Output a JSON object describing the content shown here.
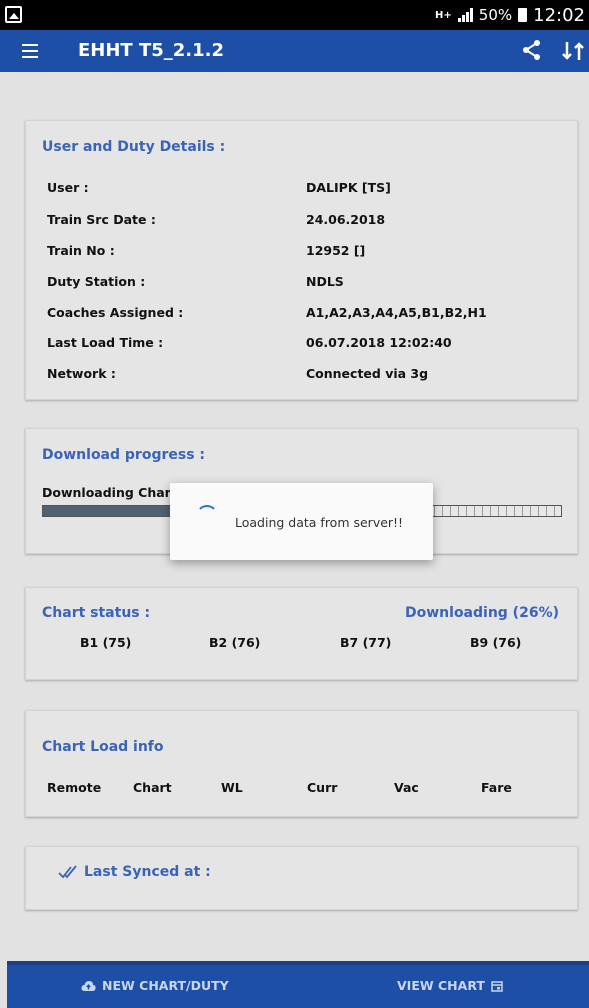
{
  "status_bar": {
    "network": "H+",
    "battery": "50%",
    "time": "12:02"
  },
  "app_bar": {
    "title": "EHHT T5_2.1.2"
  },
  "user_duty": {
    "title": "User and Duty Details :",
    "rows": [
      {
        "label": "User :",
        "value": "DALIPK [TS]"
      },
      {
        "label": "Train Src Date :",
        "value": "24.06.2018"
      },
      {
        "label": "Train No :",
        "value": "12952 []"
      },
      {
        "label": "Duty Station :",
        "value": "NDLS"
      },
      {
        "label": "Coaches Assigned :",
        "value": "A1,A2,A3,A4,A5,B1,B2,H1"
      },
      {
        "label": "Last Load Time :",
        "value": "06.07.2018 12:02:40"
      },
      {
        "label": "Network :",
        "value": "Connected via 3g"
      }
    ]
  },
  "download": {
    "title": "Download progress :",
    "label": "Downloading Chart",
    "progress": 0.26
  },
  "dialog": {
    "message": "Loading data from server!!"
  },
  "chart_status": {
    "title": "Chart status :",
    "status": "Downloading (26%)",
    "coaches": [
      "B1 (75)",
      "B2 (76)",
      "B7 (77)",
      "B9 (76)"
    ]
  },
  "chart_load_info": {
    "title": "Chart Load info",
    "columns": [
      "Remote",
      "Chart",
      "WL",
      "Curr",
      "Vac",
      "Fare"
    ]
  },
  "sync": {
    "label": "Last Synced at :"
  },
  "bottom_bar": {
    "new_chart_label": "NEW CHART/DUTY",
    "view_chart_label": "VIEW CHART"
  },
  "colors": {
    "primary": "#1e4fa6",
    "accent_text": "#3b63b7",
    "progress_fill": "#4e6272"
  }
}
